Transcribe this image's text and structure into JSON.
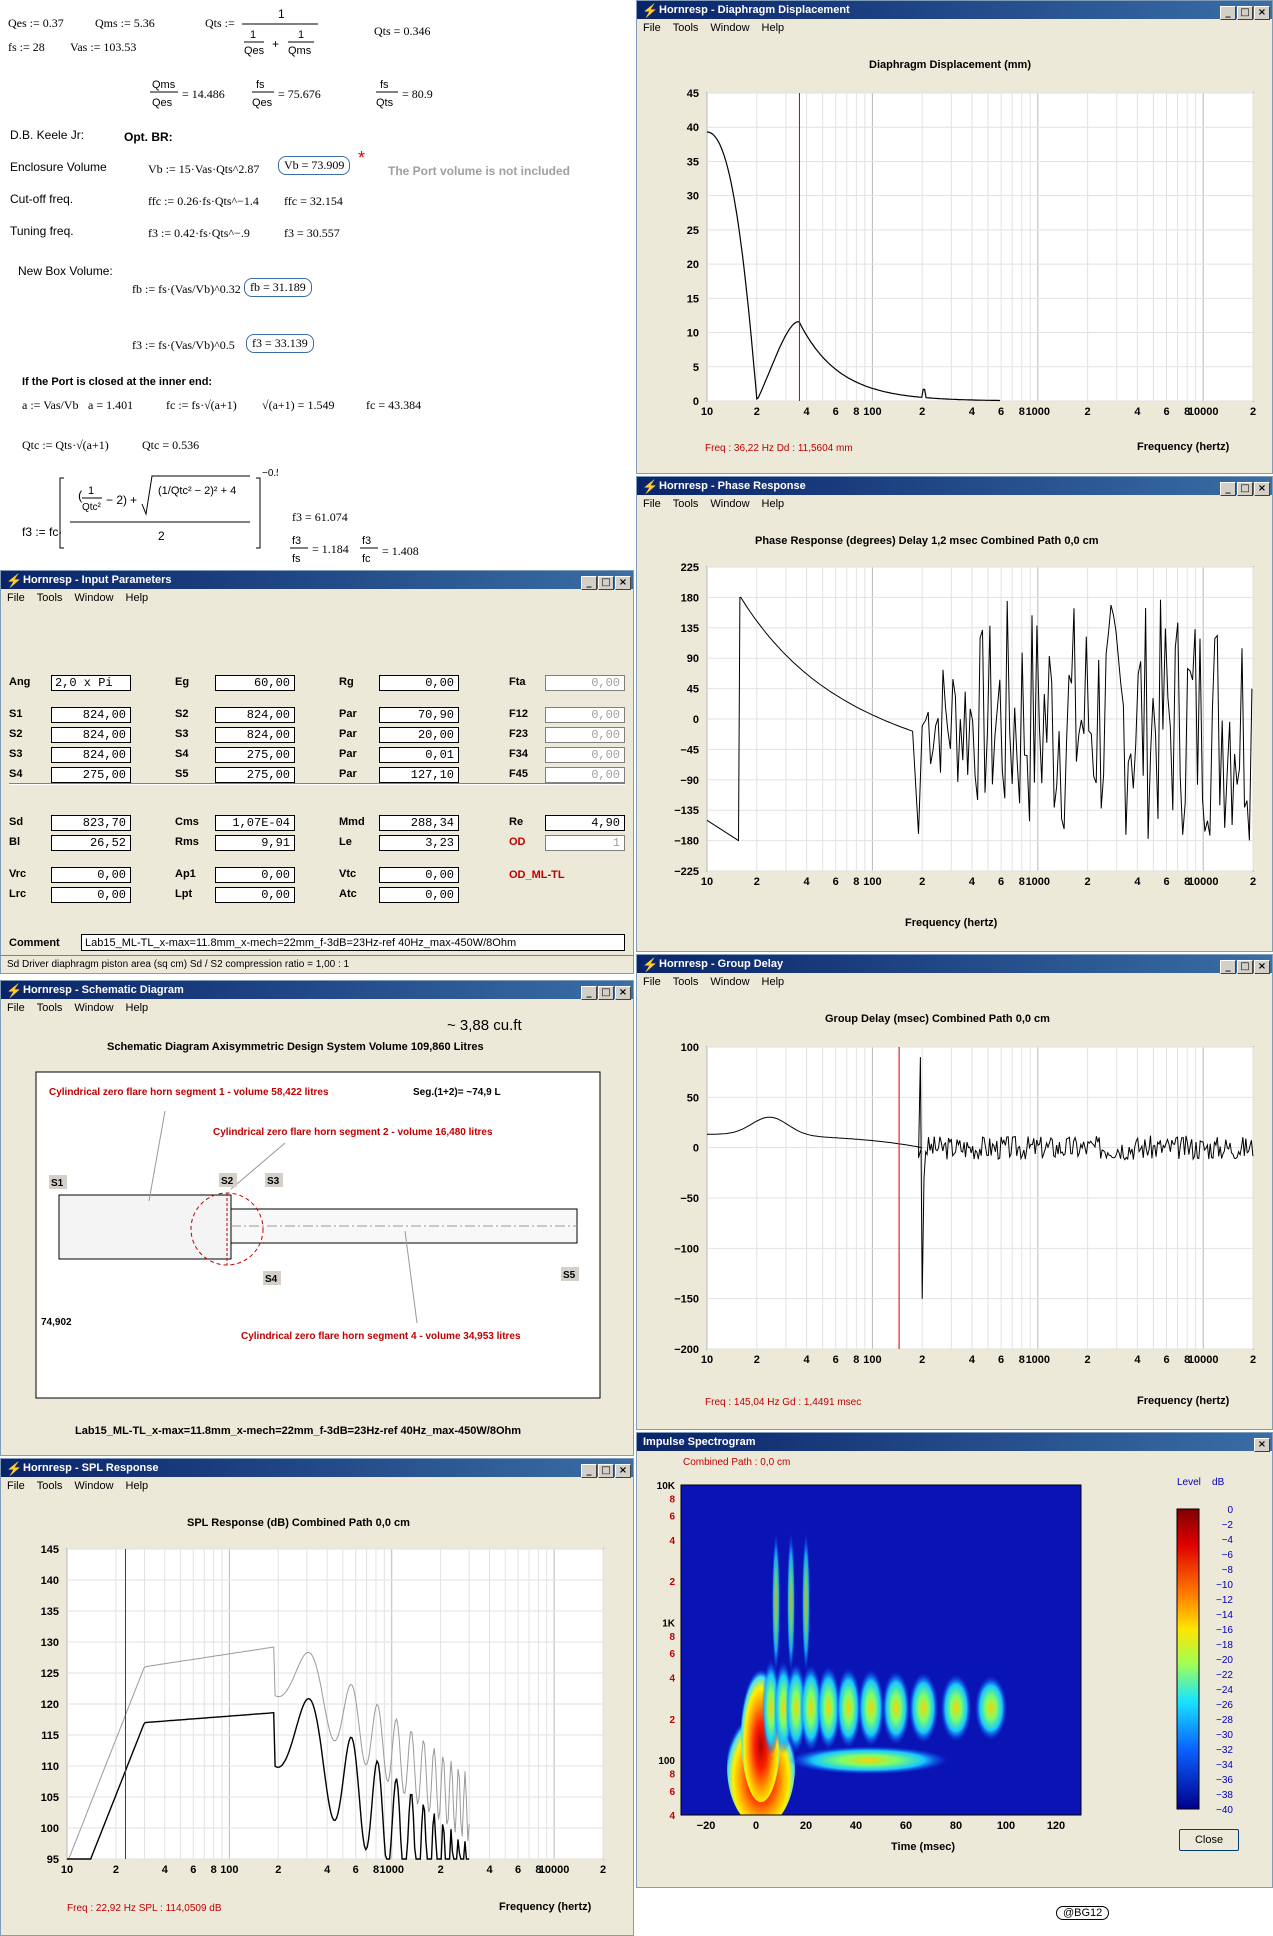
{
  "mathcad": {
    "qes": "Qes := 0.37",
    "qms": "Qms := 5.36",
    "qts_def": "Qts :=",
    "qts_val": "Qts = 0.346",
    "fs": "fs := 28",
    "vas": "Vas := 103.53",
    "ratio1": "= 14.486",
    "ratio2": "= 75.676",
    "ratio3": "= 80.9",
    "author": "D.B. Keele Jr:",
    "opt": "Opt. BR:",
    "enc_label": "Enclosure Volume",
    "enc_formula": "Vb := 15·Vas·Qts^2.87",
    "enc_val": "Vb = 73.909",
    "star": "*",
    "note": "The Port volume is not included",
    "cut_label": "Cut-off freq.",
    "cut_formula": "ffc := 0.26·fs·Qts^−1.4",
    "cut_val": "ffc = 32.154",
    "tun_label": "Tuning freq.",
    "tun_formula": "f3 := 0.42·fs·Qts^−.9",
    "tun_val": "f3 = 30.557",
    "newbox": "New Box Volume:",
    "fb_formula": "fb := fs·(Vas/Vb)^0.32",
    "fb_val": "fb = 31.189",
    "f3_formula": "f3 := fs·(Vas/Vb)^0.5",
    "f3_val": "f3 = 33.139",
    "port_closed": "If the Port is closed at the inner end:",
    "a_formula": "a := Vas/Vb",
    "a_val": "a = 1.401",
    "fc_formula": "fc := fs·√(a+1)",
    "sqrt_val": "√(a+1) = 1.549",
    "fc_val": "fc = 43.384",
    "qtc_formula": "Qtc := Qts·√(a+1)",
    "qtc_val": "Qtc = 0.536",
    "f3b_val": "f3 = 61.074",
    "f3fs": "= 1.184",
    "f3fc": "= 1.408"
  },
  "menu": [
    "File",
    "Tools",
    "Window",
    "Help"
  ],
  "diaphragm": {
    "window_title": "Hornresp - Diaphragm Displacement",
    "chart_title": "Diaphragm Displacement (mm)",
    "xlabel": "Frequency (hertz)",
    "readout": "Freq : 36,22 Hz      Dd : 11,5604 mm",
    "yticks": [
      "45",
      "40",
      "35",
      "30",
      "25",
      "20",
      "15",
      "10",
      "5",
      "0"
    ]
  },
  "phase": {
    "window_title": "Hornresp - Phase Response",
    "chart_title": "Phase Response (degrees)    Delay 1,2 msec    Combined    Path 0,0 cm",
    "xlabel": "Frequency (hertz)",
    "yticks": [
      "225",
      "180",
      "135",
      "90",
      "45",
      "0",
      "−45",
      "−90",
      "−135",
      "−180",
      "−225"
    ]
  },
  "group": {
    "window_title": "Hornresp - Group Delay",
    "chart_title": "Group Delay (msec)    Combined    Path 0,0 cm",
    "xlabel": "Frequency (hertz)",
    "readout": "Freq : 145,04 Hz      Gd : 1,4491 msec",
    "yticks": [
      "100",
      "50",
      "0",
      "−50",
      "−100",
      "−150",
      "−200"
    ]
  },
  "spl": {
    "window_title": "Hornresp - SPL Response",
    "chart_title": "SPL Response (dB)    Combined    Path 0,0 cm",
    "xlabel": "Frequency (hertz)",
    "readout": "Freq : 22,92 Hz      SPL : 114,0509 dB",
    "yticks": [
      "145",
      "140",
      "135",
      "130",
      "125",
      "120",
      "115",
      "110",
      "105",
      "100",
      "95"
    ]
  },
  "freq_ticks": [
    "10",
    "2",
    "4",
    "6",
    "8",
    "100",
    "2",
    "4",
    "6",
    "8",
    "1000",
    "2",
    "4",
    "6",
    "8",
    "10000",
    "2"
  ],
  "input": {
    "window_title": "Hornresp - Input Parameters",
    "fields": [
      {
        "l": "Ang",
        "v": "2,0 x Pi"
      },
      {
        "l": "Eg",
        "v": "60,00"
      },
      {
        "l": "Rg",
        "v": "0,00"
      },
      {
        "l": "Fta",
        "v": "0,00"
      },
      {
        "l": "S1",
        "v": "824,00"
      },
      {
        "l": "S2",
        "v": "824,00"
      },
      {
        "l": "Par",
        "v": "70,90"
      },
      {
        "l": "F12",
        "v": "0,00"
      },
      {
        "l": "S2",
        "v": "824,00"
      },
      {
        "l": "S3",
        "v": "824,00"
      },
      {
        "l": "Par",
        "v": "20,00"
      },
      {
        "l": "F23",
        "v": "0,00"
      },
      {
        "l": "S3",
        "v": "824,00"
      },
      {
        "l": "S4",
        "v": "275,00"
      },
      {
        "l": "Par",
        "v": "0,01"
      },
      {
        "l": "F34",
        "v": "0,00"
      },
      {
        "l": "S4",
        "v": "275,00"
      },
      {
        "l": "S5",
        "v": "275,00"
      },
      {
        "l": "Par",
        "v": "127,10"
      },
      {
        "l": "F45",
        "v": "0,00"
      },
      {
        "l": "Sd",
        "v": "823,70"
      },
      {
        "l": "Cms",
        "v": "1,07E-04"
      },
      {
        "l": "Mmd",
        "v": "288,34"
      },
      {
        "l": "Re",
        "v": "4,90"
      },
      {
        "l": "Bl",
        "v": "26,52"
      },
      {
        "l": "Rms",
        "v": "9,91"
      },
      {
        "l": "Le",
        "v": "3,23"
      },
      {
        "l": "OD",
        "v": "1"
      },
      {
        "l": "Vrc",
        "v": "0,00"
      },
      {
        "l": "Ap1",
        "v": "0,00"
      },
      {
        "l": "Vtc",
        "v": "0,00"
      },
      {
        "l": "Lrc",
        "v": "0,00"
      },
      {
        "l": "Lpt",
        "v": "0,00"
      },
      {
        "l": "Atc",
        "v": "0,00"
      }
    ],
    "od_label": "OD_ML-TL",
    "comment_label": "Comment",
    "comment": "Lab15_ML-TL_x-max=11.8mm_x-mech=22mm_f-3dB=23Hz-ref 40Hz_max-450W/8Ohm",
    "status": "Sd   Driver diaphragm piston area (sq cm)   Sd / S2 compression ratio = 1,00 : 1"
  },
  "schematic": {
    "window_title": "Hornresp - Schematic Diagram",
    "cuft": "~ 3,88 cu.ft",
    "heading": "Schematic Diagram    Axisymmetric Design    System Volume 109,860 Litres",
    "seg1": "Cylindrical zero flare horn segment 1 - volume 58,422 litres",
    "seg12": "Seg.(1+2)= ~74,9 L",
    "seg2": "Cylindrical zero flare horn segment 2 - volume 16,480 litres",
    "seg4": "Cylindrical zero flare horn segment 4 - volume 34,953 litres",
    "s1": "S1",
    "s2": "S2",
    "s3": "S3",
    "s4": "S4",
    "s5": "S5",
    "dim": "74,902",
    "footer": "Lab15_ML-TL_x-max=11.8mm_x-mech=22mm_f-3dB=23Hz-ref 40Hz_max-450W/8Ohm"
  },
  "spectrogram": {
    "window_title": "Impulse Spectrogram",
    "subtitle": "Combined      Path : 0,0 cm",
    "yticks": [
      "10K",
      "8",
      "6",
      "4",
      "2",
      "1K",
      "8",
      "6",
      "4",
      "2",
      "100",
      "8",
      "6",
      "4"
    ],
    "xticks": [
      "−20",
      "0",
      "20",
      "40",
      "60",
      "80",
      "100",
      "120"
    ],
    "xlabel": "Time (msec)",
    "level_label": "Level    dB",
    "levels": [
      "0",
      "−2",
      "−4",
      "−6",
      "−8",
      "−10",
      "−12",
      "−14",
      "−16",
      "−18",
      "−20",
      "−22",
      "−24",
      "−26",
      "−28",
      "−30",
      "−32",
      "−34",
      "−36",
      "−38",
      "−40"
    ],
    "close": "Close"
  },
  "credit": "@BG12"
}
